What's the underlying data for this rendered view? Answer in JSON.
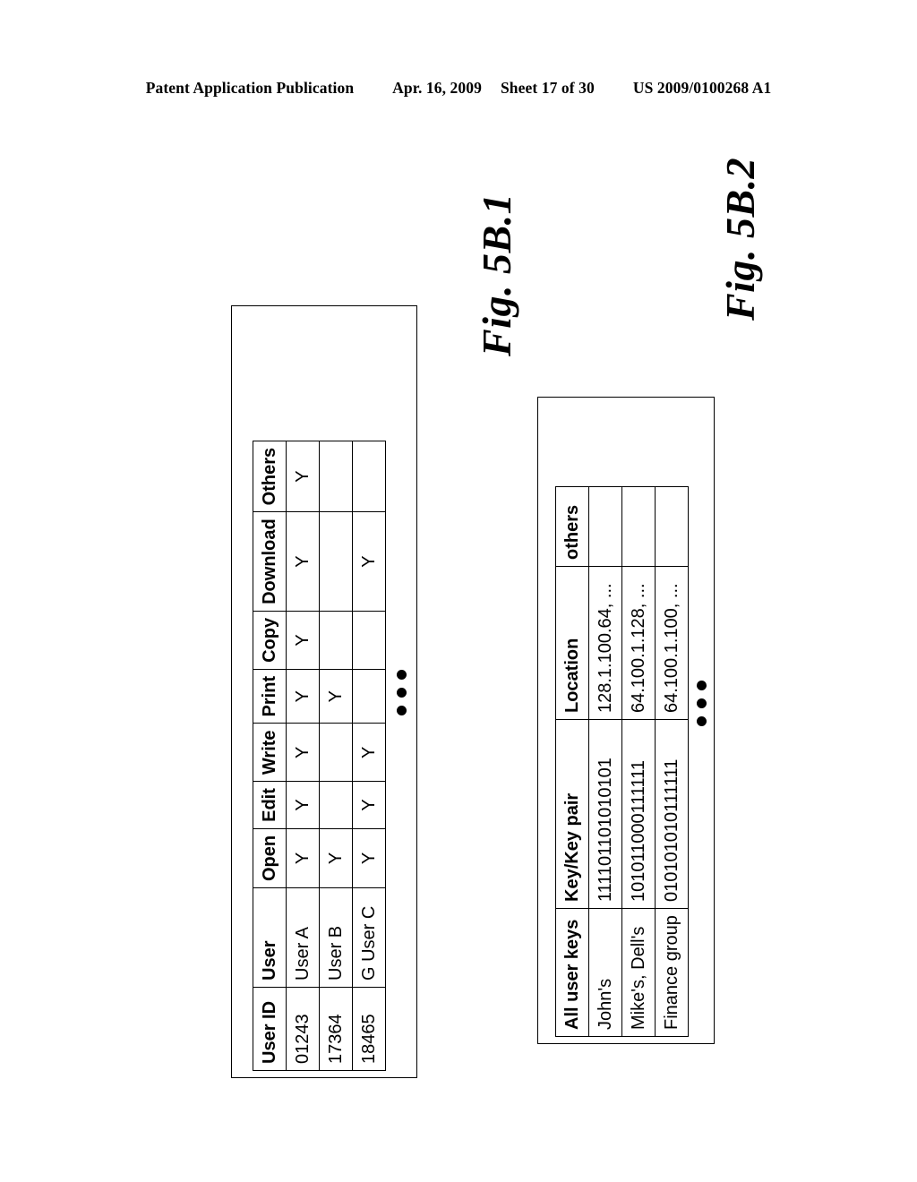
{
  "page_header": {
    "publication": "Patent Application Publication",
    "date": "Apr. 16, 2009",
    "sheet": "Sheet 17 of 30",
    "patent_number": "US 2009/0100268 A1"
  },
  "figures": [
    {
      "id": "fig-5b-1",
      "caption": "Fig. 5B.1"
    },
    {
      "id": "fig-5b-2",
      "caption": "Fig. 5B.2"
    }
  ],
  "table_permissions": {
    "caption": "Fig. 5B.1",
    "columns": [
      "User ID",
      "User",
      "Open",
      "Edit",
      "Write",
      "Print",
      "Copy",
      "Download",
      "Others"
    ],
    "rows": [
      {
        "user_id": "01243",
        "user": "User A",
        "open": "Y",
        "edit": "Y",
        "write": "Y",
        "print": "Y",
        "copy": "Y",
        "download": "Y",
        "others": "Y"
      },
      {
        "user_id": "17364",
        "user": "User B",
        "open": "Y",
        "edit": "",
        "write": "",
        "print": "Y",
        "copy": "",
        "download": "",
        "others": ""
      },
      {
        "user_id": "18465",
        "user": "G User C",
        "open": "Y",
        "edit": "Y",
        "write": "Y",
        "print": "",
        "copy": "",
        "download": "Y",
        "others": ""
      }
    ],
    "continuation": "•••"
  },
  "table_keys": {
    "caption": "Fig. 5B.2",
    "columns": [
      "All user keys",
      "Key/Key pair",
      "Location",
      "others"
    ],
    "rows": [
      {
        "name": "John's",
        "key": "111101101010101",
        "location": "128.1.100.64, ...",
        "others": ""
      },
      {
        "name": "Mike's, Dell's",
        "key": "101011000111111",
        "location": "64.100.1.128, ...",
        "others": ""
      },
      {
        "name": "Finance group",
        "key": "010101010111111",
        "location": "64.100.1.100, ...",
        "others": ""
      }
    ],
    "continuation": "•••"
  }
}
